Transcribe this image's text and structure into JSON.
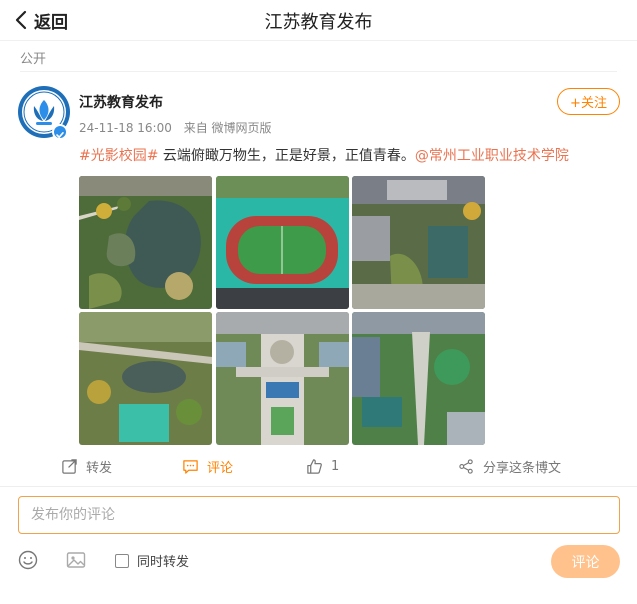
{
  "header": {
    "back_label": "返回",
    "title": "江苏教育发布"
  },
  "visibility": "公开",
  "post": {
    "author": "江苏教育发布",
    "time": "24-11-18 16:00",
    "source": "来自 微博网页版",
    "follow_label": "+关注",
    "hashtag": "#光影校园#",
    "text": " 云端俯瞰万物生，正是好景，正值青春。",
    "mention": "@常州工业职业技术学院",
    "photos": [
      {
        "name": "aerial-lake-garden"
      },
      {
        "name": "aerial-sports-field"
      },
      {
        "name": "aerial-campus-buildings"
      },
      {
        "name": "aerial-pond-trees"
      },
      {
        "name": "aerial-central-plaza"
      },
      {
        "name": "aerial-campus-greenery"
      }
    ]
  },
  "actions": {
    "repost": "转发",
    "comment": "评论",
    "like_count": "1",
    "share": "分享这条博文"
  },
  "composer": {
    "placeholder": "发布你的评论",
    "value": "",
    "repost_checkbox_label": "同时转发",
    "repost_checked": false,
    "submit_label": "评论"
  },
  "colors": {
    "accent": "#ff8200",
    "link": "#eb7350",
    "submit_disabled": "#ffc28c",
    "verified": "#2c8ee8"
  }
}
